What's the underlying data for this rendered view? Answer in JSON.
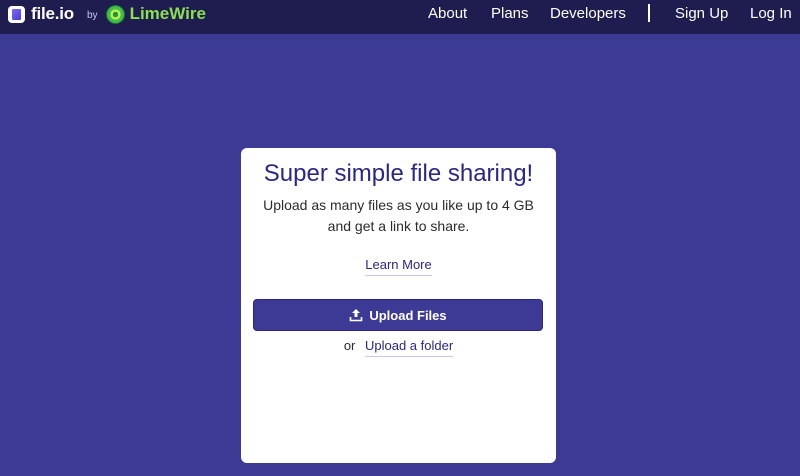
{
  "brand": {
    "name": "file.io",
    "by": "by",
    "partner": "LimeWire",
    "logo_icon": "file-io-logo-icon",
    "partner_icon": "limewire-logo-icon"
  },
  "nav": {
    "about": "About",
    "plans": "Plans",
    "developers": "Developers",
    "sign_up": "Sign Up",
    "log_in": "Log In"
  },
  "card": {
    "title": "Super simple file sharing!",
    "subtitle_line1": "Upload as many files as you like up to 4 GB",
    "subtitle_line2": "and get a link to share.",
    "learn_more": "Learn More",
    "upload_button": "Upload Files",
    "upload_icon": "upload-icon",
    "or": "or",
    "upload_folder": "Upload a folder"
  },
  "colors": {
    "background": "#3d3a96",
    "navbar": "#1f1c4f",
    "accent": "#2b2784",
    "partner": "#8be04f"
  }
}
